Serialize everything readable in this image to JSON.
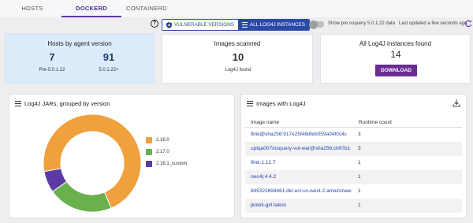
{
  "tabs": [
    {
      "label": "HOSTS"
    },
    {
      "label": "DOCKERD"
    },
    {
      "label": "CONTAINERD"
    }
  ],
  "active_tab": "DOCKERD",
  "toolbar": {
    "help_label": "?",
    "vulnerable_label": "VULNERABLE VERSIONS",
    "all_instances_label": "ALL LOG4J INSTANCES",
    "selected": "ALL LOG4J INSTANCES",
    "prerelease_toggle_label": "Show pre osquery 5.0.1.22 data",
    "prerelease_toggle_on": false,
    "last_updated": "Last updated a few seconds ago"
  },
  "summary": {
    "hosts": {
      "title": "Hosts by agent version",
      "pre_value": "7",
      "pre_label": "Pre-5.0.1.22",
      "post_value": "91",
      "post_label": "5.0.1.22+"
    },
    "images": {
      "title": "Images scanned",
      "value": "10",
      "label": "Log4J found"
    },
    "instances": {
      "title": "All Log4J instances found",
      "value": "14",
      "button": "DOWNLOAD"
    }
  },
  "jars_panel": {
    "title": "Log4J JARs, grouped by version",
    "icon": "list-icon"
  },
  "chart_data": {
    "type": "pie",
    "donut": true,
    "labels": [
      "2.16.0",
      "2.17.0",
      "2.16.1_custom"
    ],
    "values": [
      10,
      3,
      1
    ],
    "colors": [
      "#f0a03c",
      "#6ab04c",
      "#5b3aa6"
    ]
  },
  "images_panel": {
    "title": "Images with Log4J",
    "download_icon": "download-icon",
    "columns": [
      "Image name",
      "Runtime count"
    ],
    "rows": [
      {
        "image": "flink@sha256:917e25f48dfeb059a04f0c4c",
        "count": "3"
      },
      {
        "image": "uptqa007/osquery-vul-war@sha256:cb97b1",
        "count": "3"
      },
      {
        "image": "flink:1.12.7",
        "count": "1"
      },
      {
        "image": "neo4j:4.4.2",
        "count": "1"
      },
      {
        "image": "845322694461.dkr.ecr.us-west-2.amazonaw",
        "count": "1"
      },
      {
        "image": "jkoleti-girl:latest",
        "count": "1"
      }
    ]
  },
  "colors": {
    "accent": "#5b3aa6",
    "primary_blue": "#2b4aa8",
    "card_blue": "#dcecfb",
    "download_button": "#6b2c94",
    "link": "#2244aa"
  }
}
